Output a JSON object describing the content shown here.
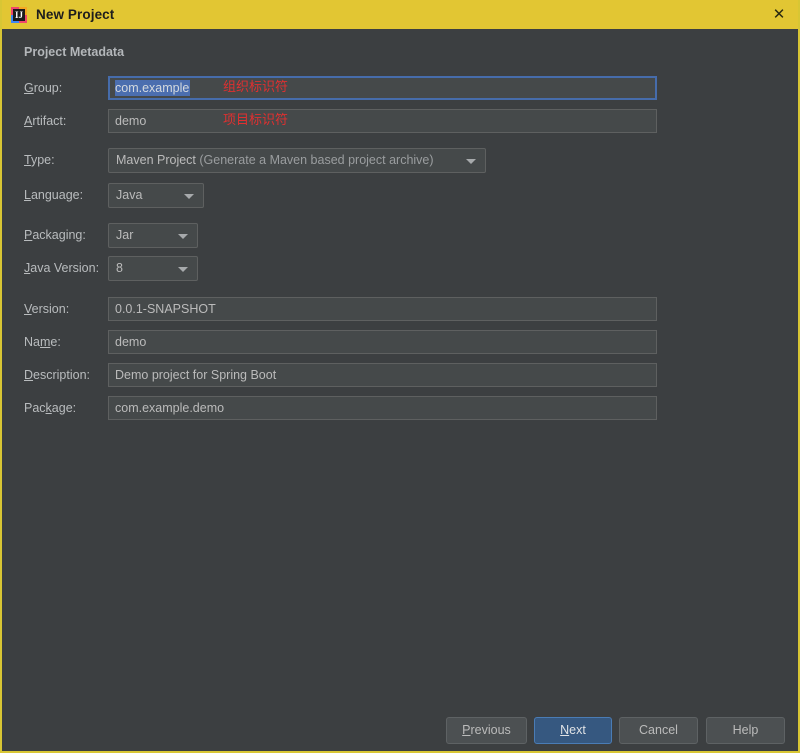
{
  "window": {
    "title": "New Project",
    "app_icon": "intellij-idea-icon",
    "close_icon": "close-icon",
    "titlebar_color": "#e2c633",
    "background_color": "#3c3f41",
    "border_color": "#d8c634"
  },
  "section": {
    "title": "Project Metadata"
  },
  "form": {
    "group": {
      "label": "Group:",
      "mnemonic": "G",
      "value": "com.example",
      "selected": true,
      "focused": true,
      "annotation": "组织标识符"
    },
    "artifact": {
      "label": "Artifact:",
      "mnemonic": "A",
      "value": "demo",
      "annotation": "项目标识符"
    },
    "type": {
      "label": "Type:",
      "mnemonic": "T",
      "value": "Maven Project",
      "value_hint": "(Generate a Maven based project archive)"
    },
    "language": {
      "label": "Language:",
      "mnemonic": "L",
      "value": "Java"
    },
    "packaging": {
      "label": "Packaging:",
      "mnemonic": "P",
      "value": "Jar"
    },
    "java_version": {
      "label": "Java Version:",
      "mnemonic": "J",
      "value": "8"
    },
    "version": {
      "label": "Version:",
      "mnemonic": "V",
      "value": "0.0.1-SNAPSHOT"
    },
    "name": {
      "label": "Name:",
      "mnemonic": "m",
      "value": "demo"
    },
    "description": {
      "label": "Description:",
      "mnemonic": "D",
      "value": "Demo project for Spring Boot"
    },
    "package": {
      "label": "Package:",
      "mnemonic": "k",
      "value": "com.example.demo"
    }
  },
  "buttons": {
    "previous": {
      "label": "Previous",
      "mnemonic": "P"
    },
    "next": {
      "label": "Next",
      "mnemonic": "N",
      "primary": true,
      "color": "#365880"
    },
    "cancel": {
      "label": "Cancel"
    },
    "help": {
      "label": "Help"
    }
  }
}
